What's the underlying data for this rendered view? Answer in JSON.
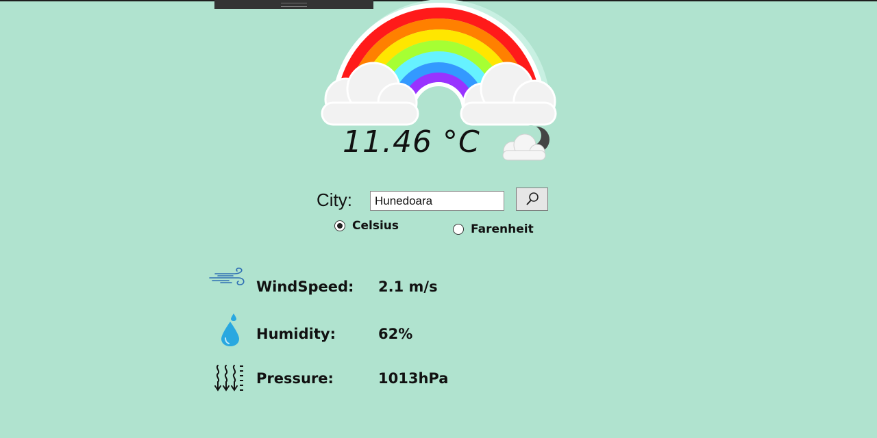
{
  "weather": {
    "temperature": "11.46 °C",
    "condition_icon": "cloud-moon-icon"
  },
  "search": {
    "city_label": "City:",
    "city_value": "Hunedoara",
    "search_icon": "search-icon"
  },
  "units": {
    "options": [
      "Celsius",
      "Farenheit"
    ],
    "selected": "Celsius"
  },
  "stats": [
    {
      "icon": "wind-icon",
      "label": "WindSpeed:",
      "value": "2.1 m/s"
    },
    {
      "icon": "water-drop-icon",
      "label": "Humidity:",
      "value": "62%"
    },
    {
      "icon": "pressure-icon",
      "label": "Pressure:",
      "value": "1013hPa"
    }
  ],
  "colors": {
    "background": "#b0e3cf",
    "rainbow": [
      "#ff1a1a",
      "#ff8000",
      "#ffe600",
      "#a6ff33",
      "#66f2ff",
      "#3399ff",
      "#9933ff"
    ],
    "water_drop": "#29a8e0",
    "wind": "#2f6fb4"
  }
}
